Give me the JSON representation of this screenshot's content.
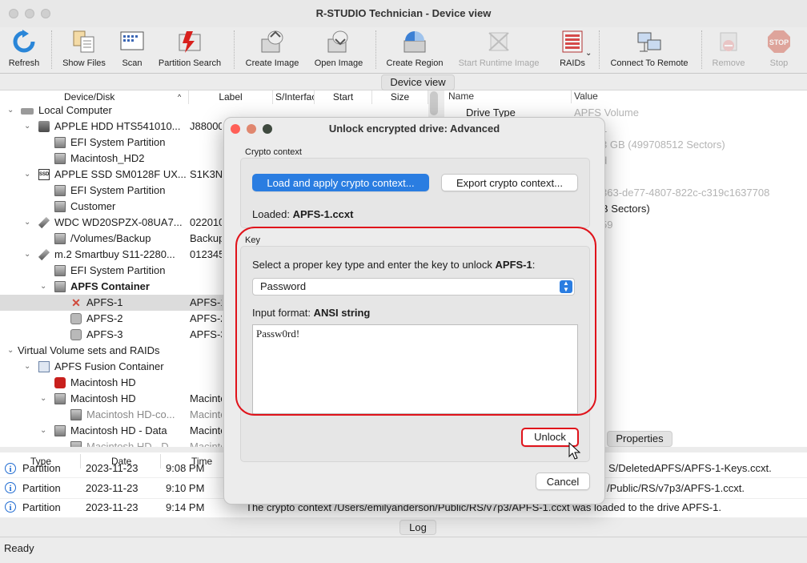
{
  "window": {
    "title": "R-STUDIO Technician - Device view"
  },
  "toolbar": {
    "buttons": [
      {
        "label": "Refresh",
        "icon": "refresh-icon",
        "enabled": true
      },
      {
        "label": "Show Files",
        "icon": "show-files-icon",
        "enabled": true
      },
      {
        "label": "Scan",
        "icon": "scan-icon",
        "enabled": true
      },
      {
        "label": "Partition Search",
        "icon": "partition-search-icon",
        "enabled": true
      },
      {
        "label": "Create Image",
        "icon": "create-image-icon",
        "enabled": true
      },
      {
        "label": "Open Image",
        "icon": "open-image-icon",
        "enabled": true
      },
      {
        "label": "Create Region",
        "icon": "create-region-icon",
        "enabled": true
      },
      {
        "label": "Start Runtime Image",
        "icon": "runtime-image-icon",
        "enabled": false
      },
      {
        "label": "RAIDs",
        "icon": "raids-icon",
        "enabled": true
      },
      {
        "label": "Connect To Remote",
        "icon": "connect-remote-icon",
        "enabled": true
      },
      {
        "label": "Remove",
        "icon": "remove-icon",
        "enabled": false
      },
      {
        "label": "Stop",
        "icon": "stop-icon",
        "enabled": false
      }
    ],
    "stop_text": "STOP"
  },
  "device_view_tab": "Device view",
  "device_tree": {
    "columns": [
      "Device/Disk",
      "Label",
      "S/Interfac",
      "Start",
      "Size"
    ],
    "rows": [
      {
        "name": "Local Computer",
        "label": "",
        "bold": false,
        "selected": false
      },
      {
        "name": "APPLE HDD HTS541010...",
        "label": "J88000",
        "bold": false,
        "selected": false
      },
      {
        "name": "EFI System Partition",
        "label": "",
        "bold": false,
        "selected": false
      },
      {
        "name": "Macintosh_HD2",
        "label": "",
        "bold": false,
        "selected": false
      },
      {
        "name": "APPLE SSD SM0128F UX...",
        "label": "S1K3NY",
        "bold": false,
        "selected": false
      },
      {
        "name": "EFI System Partition",
        "label": "",
        "bold": false,
        "selected": false
      },
      {
        "name": "Customer",
        "label": "",
        "bold": false,
        "selected": false
      },
      {
        "name": "WDC WD20SPZX-08UA7...",
        "label": "022010",
        "bold": false,
        "selected": false
      },
      {
        "name": "/Volumes/Backup",
        "label": "Backup",
        "bold": false,
        "selected": false
      },
      {
        "name": "m.2 Smartbuy S11-2280...",
        "label": "012345",
        "bold": false,
        "selected": false
      },
      {
        "name": "EFI System Partition",
        "label": "",
        "bold": false,
        "selected": false
      },
      {
        "name": "APFS Container",
        "label": "",
        "bold": true,
        "selected": false
      },
      {
        "name": "APFS-1",
        "label": "APFS-1",
        "bold": false,
        "selected": true
      },
      {
        "name": "APFS-2",
        "label": "APFS-2",
        "bold": false,
        "selected": false
      },
      {
        "name": "APFS-3",
        "label": "APFS-3",
        "bold": false,
        "selected": false
      },
      {
        "name": "Virtual Volume sets and RAIDs",
        "label": "",
        "bold": false,
        "selected": false
      },
      {
        "name": "APFS Fusion Container",
        "label": "",
        "bold": false,
        "selected": false
      },
      {
        "name": "Macintosh HD",
        "label": "",
        "bold": false,
        "selected": false
      },
      {
        "name": "Macintosh HD",
        "label": "Macinto",
        "bold": false,
        "selected": false
      },
      {
        "name": "Macintosh HD-co...",
        "label": "Macinto",
        "bold": false,
        "selected": false
      },
      {
        "name": "Macintosh HD - Data",
        "label": "Macinto",
        "bold": false,
        "selected": false
      },
      {
        "name": "Macintosh HD - D...",
        "label": "Macinto",
        "bold": false,
        "selected": false
      }
    ]
  },
  "properties": {
    "columns": [
      "Name",
      "Value"
    ],
    "rows": [
      {
        "name": "Drive Type",
        "value": "APFS Volume"
      },
      {
        "name": "",
        "value": "1"
      },
      {
        "name": "",
        "value": "3 GB (499708512 Sectors)"
      },
      {
        "name": "",
        "value": "d"
      },
      {
        "name": "",
        "value": "363-de77-4807-822c-c319c1637708"
      },
      {
        "name": "",
        "value": "B Sectors)"
      },
      {
        "name": "",
        "value": "59"
      }
    ],
    "tab": "Properties"
  },
  "log": {
    "columns": [
      "Type",
      "Date",
      "Time"
    ],
    "rows": [
      {
        "type": "Partition",
        "date": "2023-11-23",
        "time": "9:08 PM",
        "text": "S/DeletedAPFS/APFS-1-Keys.ccxt."
      },
      {
        "type": "Partition",
        "date": "2023-11-23",
        "time": "9:10 PM",
        "text": "/Public/RS/v7p3/APFS-1.ccxt."
      },
      {
        "type": "Partition",
        "date": "2023-11-23",
        "time": "9:14 PM",
        "text": "The crypto context /Users/emilyanderson/Public/RS/v7p3/APFS-1.ccxt was loaded to the drive APFS-1."
      }
    ],
    "tab": "Log"
  },
  "status": "Ready",
  "dialog": {
    "title": "Unlock encrypted drive: Advanced",
    "crypto_context_label": "Crypto context",
    "load_button": "Load and apply crypto context...",
    "export_button": "Export crypto context...",
    "loaded_prefix": "Loaded: ",
    "loaded_file": "APFS-1.ccxt",
    "key_group_label": "Key",
    "key_instruction": "Select a proper key type and enter the key to unlock ",
    "key_instruction_target": "APFS-1",
    "key_instruction_suffix": ":",
    "key_type_selected": "Password",
    "input_format_prefix": "Input format: ",
    "input_format_value": "ANSI string",
    "key_value": "Passw0rd!",
    "unlock_button": "Unlock",
    "cancel_button": "Cancel"
  },
  "colors": {
    "accent": "#2a7de1",
    "highlight_ring": "#e0131b",
    "close": "#ff5f57",
    "minimize": "#febc2e",
    "zoom": "#28c840"
  }
}
